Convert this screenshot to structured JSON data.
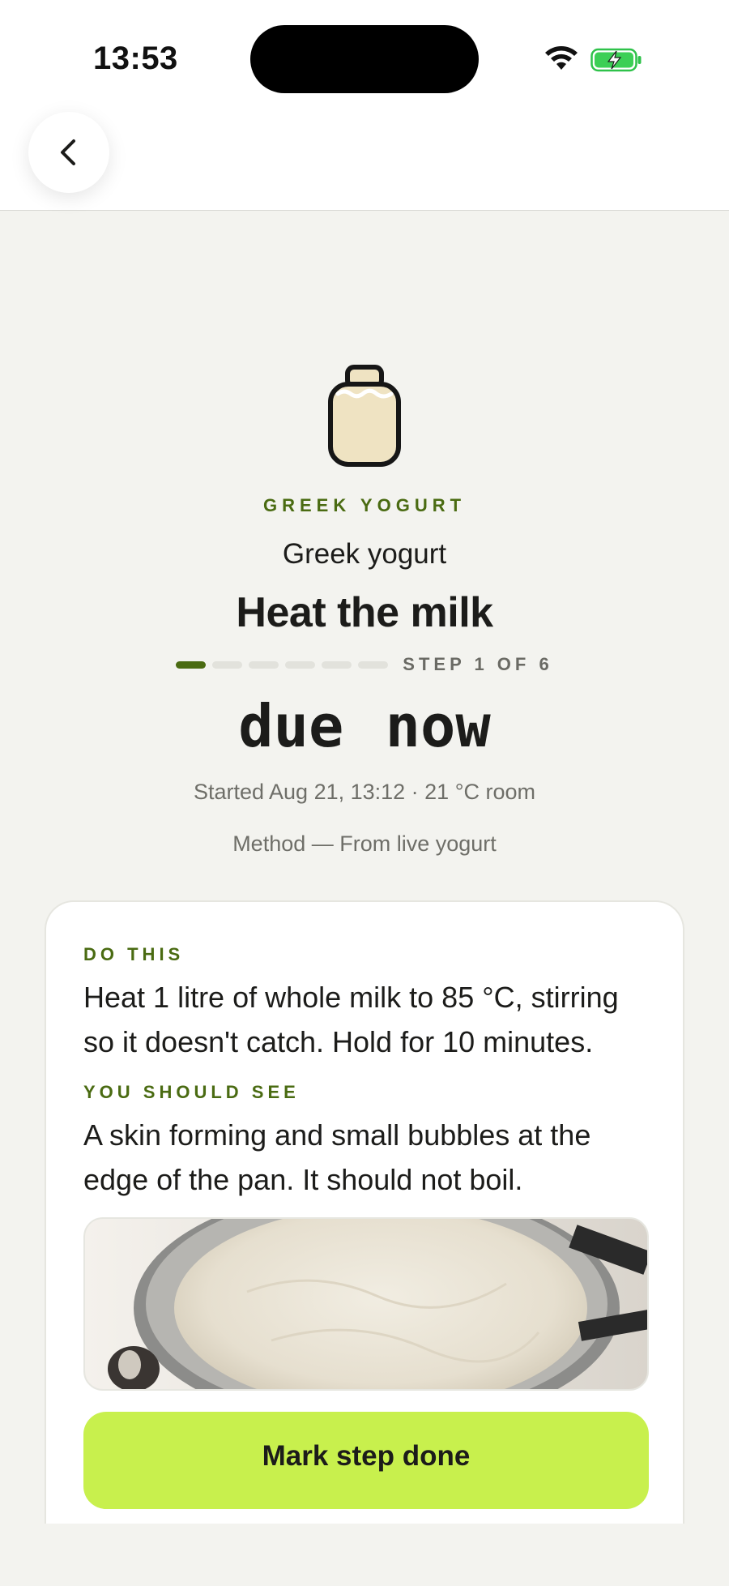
{
  "status_bar": {
    "time": "13:53"
  },
  "nav": {
    "back_icon": "chevron-left-icon"
  },
  "hero": {
    "icon": "jar-icon",
    "category": "GREEK YOGURT",
    "recipe_name": "Greek yogurt",
    "step_title": "Heat the milk",
    "step_current": 1,
    "step_total": 6,
    "step_counter": "STEP 1 OF 6",
    "due": "due now",
    "started": "Started Aug 21, 13:12 · 21 °C room",
    "method": "Method — From live yogurt"
  },
  "card": {
    "do_this_label": "DO THIS",
    "do_this_text": "Heat 1 litre of whole milk to 85 °C, stirring so it doesn't catch. Hold for 10 minutes.",
    "see_label": "YOU SHOULD SEE",
    "see_text": "A skin forming and small bubbles at the edge of the pan. It should not boil.",
    "photo_subject": "pot of heated milk",
    "button_label": "Mark step done"
  },
  "colors": {
    "accent_green": "#4a6b12",
    "button_lime": "#c8f04d",
    "background": "#f3f3ef"
  }
}
